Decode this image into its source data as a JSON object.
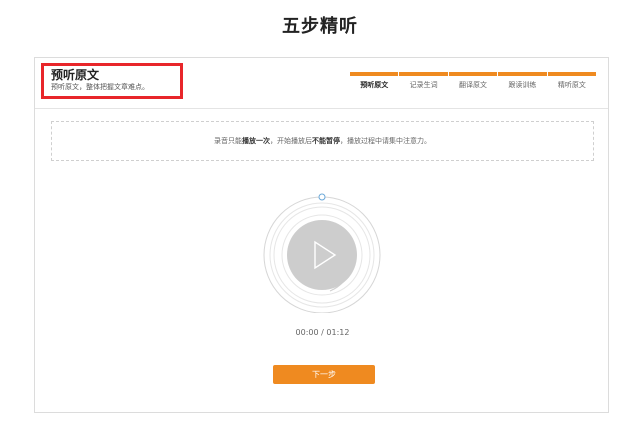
{
  "page": {
    "title": "五步精听"
  },
  "step": {
    "title": "预听原文",
    "description": "预听原文，整体把握文章难点。"
  },
  "steps": [
    {
      "label": "预听原文",
      "active": true
    },
    {
      "label": "记录生词",
      "active": false
    },
    {
      "label": "翻译原文",
      "active": false
    },
    {
      "label": "跟读训练",
      "active": false
    },
    {
      "label": "精听原文",
      "active": false
    }
  ],
  "notice": {
    "part1": "录音只能",
    "bold1": "播放一次",
    "part2": "，开始播放后",
    "bold2": "不能暂停",
    "part3": "，播放过程中请集中注意力。"
  },
  "player": {
    "time": "00:00 / 01:12",
    "progress": 0,
    "play_icon": "play-icon"
  },
  "buttons": {
    "next": "下一步"
  },
  "colors": {
    "accent": "#ef8a20",
    "highlight": "#e8262a"
  }
}
